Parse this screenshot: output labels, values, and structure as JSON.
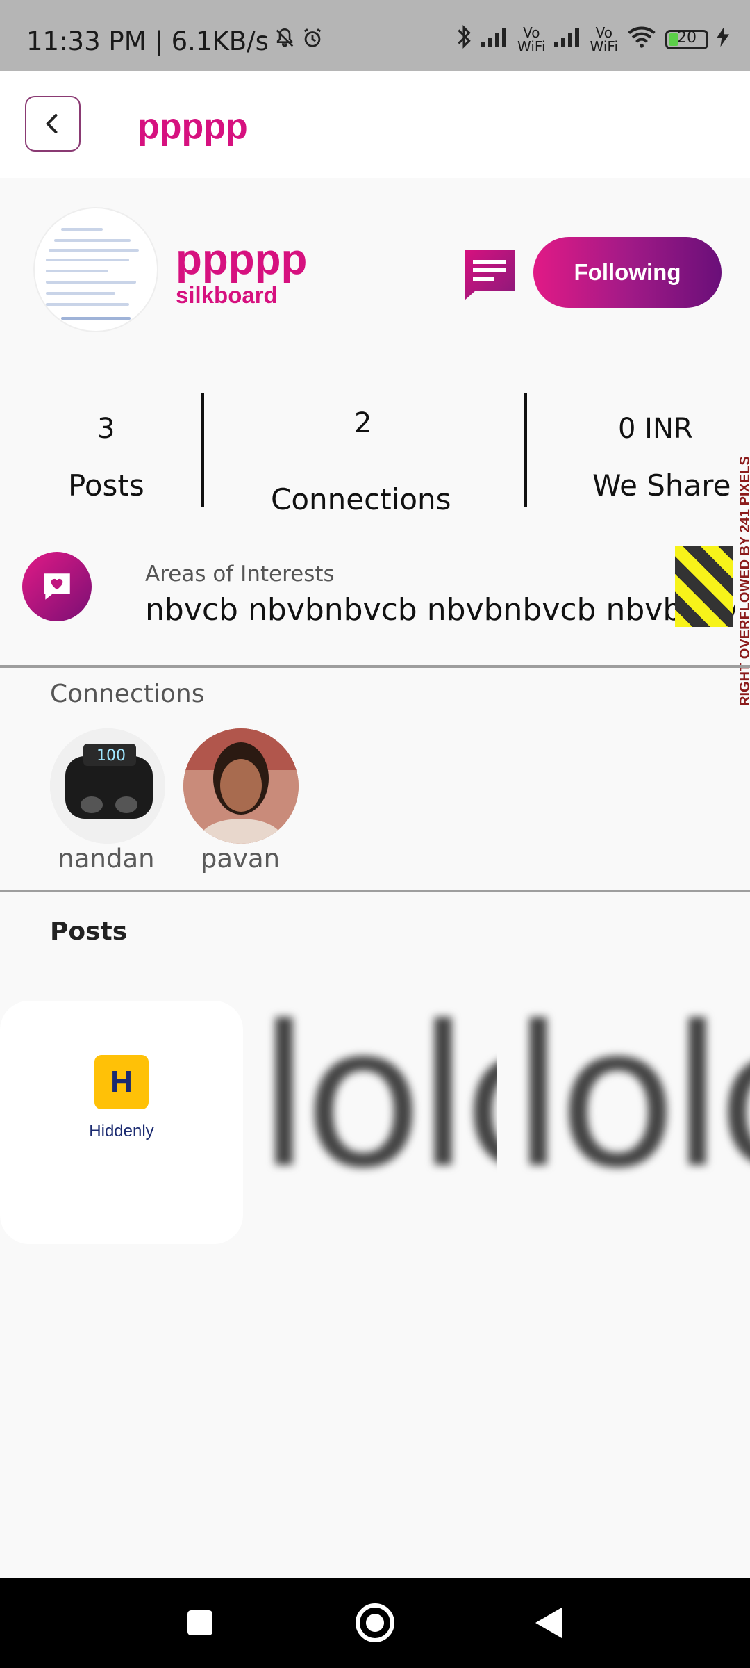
{
  "status_bar": {
    "time": "11:33 PM | 6.1KB/s",
    "wifi_label_top": "Vo",
    "wifi_label_bottom": "WiFi",
    "battery": "20"
  },
  "app_bar": {
    "title": "ppppp"
  },
  "profile": {
    "name": "ppppp",
    "subtitle": "silkboard",
    "follow_label": "Following"
  },
  "stats": {
    "posts_count": "3",
    "posts_label": "Posts",
    "connections_count": "2",
    "connections_label": "Connections",
    "share_value": "0 INR",
    "share_label": "We Share"
  },
  "interests": {
    "title": "Areas of Interests",
    "text": "nbvcb nbvbnbvcb nbvbnbvcb nbvbnbvcb",
    "overflow_warning": "RIGHT OVERFLOWED BY 241 PIXELS"
  },
  "connections": {
    "title": "Connections",
    "items": [
      {
        "name": "nandan"
      },
      {
        "name": "pavan"
      }
    ]
  },
  "posts": {
    "title": "Posts",
    "card_label": "Hiddenly",
    "card_logo_letter": "H",
    "preview_text_1": "lolo",
    "preview_text_2": "lolo"
  },
  "colors": {
    "accent": "#d6117f",
    "accent_dark": "#6a0f79"
  }
}
